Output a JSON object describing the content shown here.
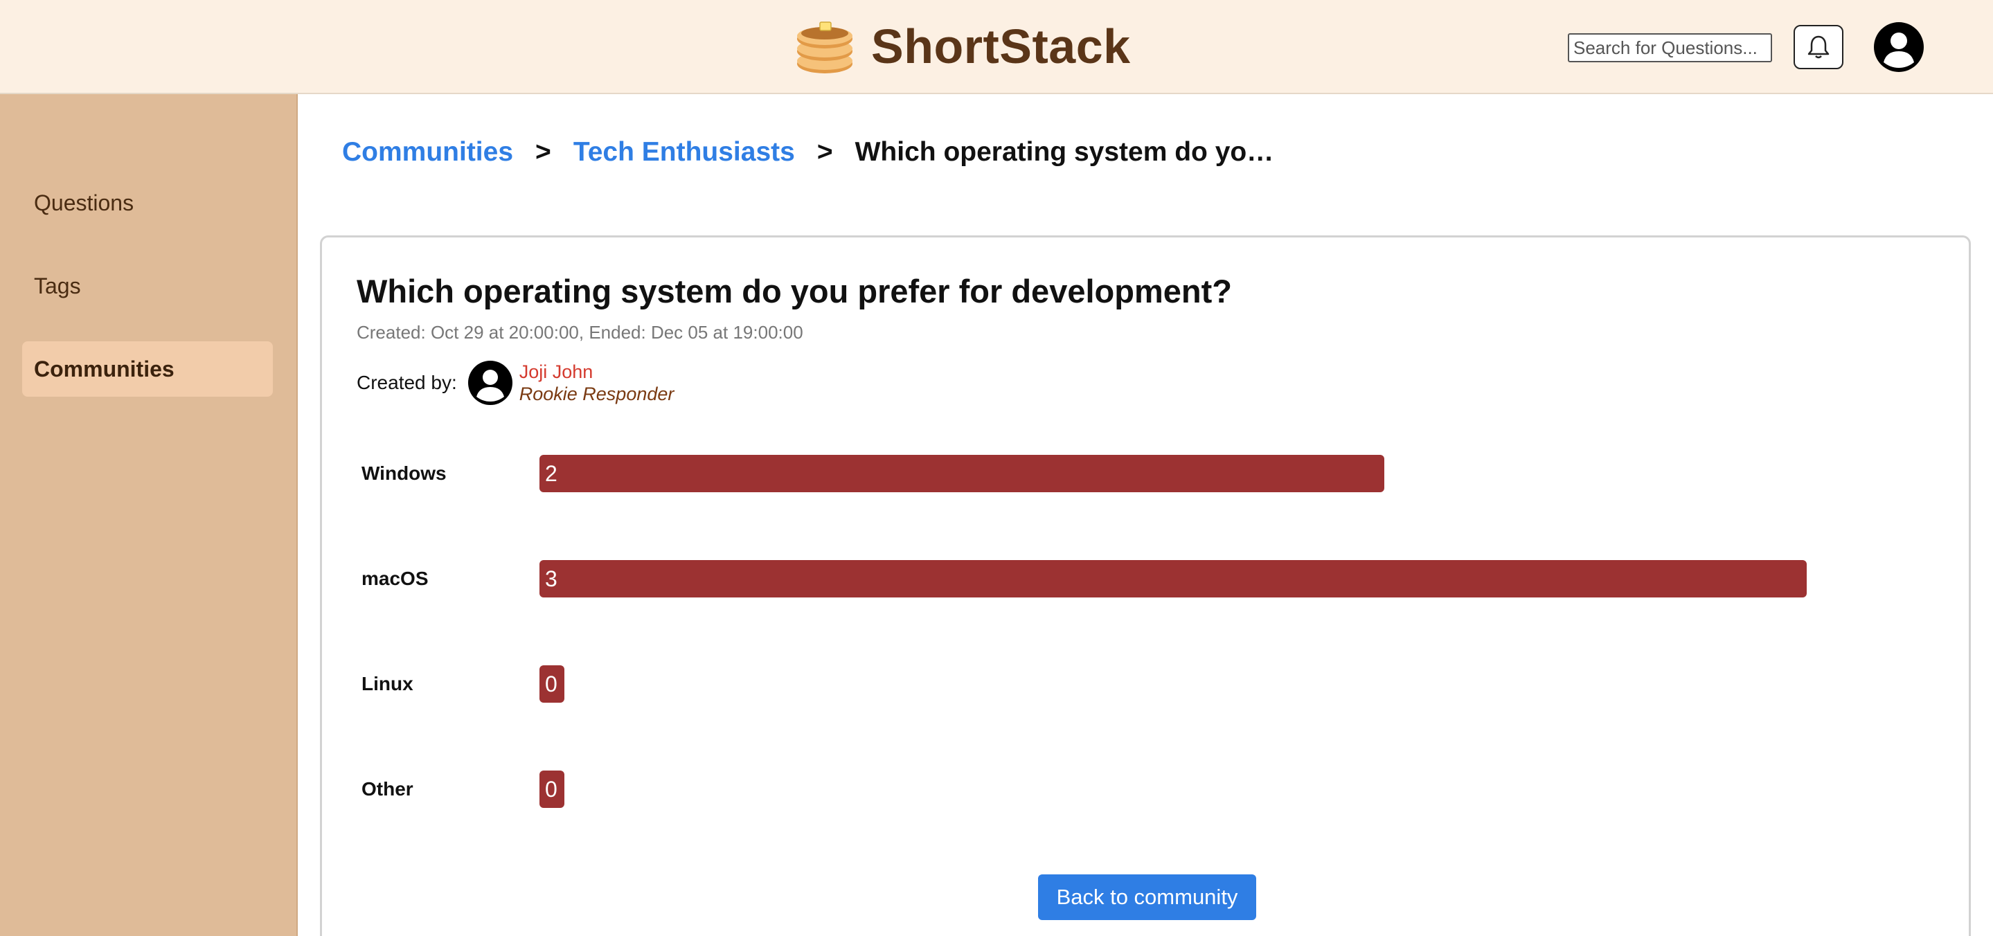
{
  "header": {
    "app_name": "ShortStack",
    "search_placeholder": "Search for Questions...",
    "logo_icon": "pancake-stack-icon",
    "notification_icon": "bell-icon",
    "profile_icon": "user-avatar-icon"
  },
  "sidebar": {
    "items": [
      {
        "label": "Questions",
        "active": false
      },
      {
        "label": "Tags",
        "active": false
      },
      {
        "label": "Communities",
        "active": true
      }
    ]
  },
  "breadcrumb": {
    "items": [
      "Communities",
      "Tech Enthusiasts",
      "Which operating system do yo…"
    ],
    "separator": ">"
  },
  "poll": {
    "title": "Which operating system do you prefer for development?",
    "dates": "Created: Oct 29 at 20:00:00, Ended: Dec 05 at 19:00:00",
    "created_by_label": "Created by:",
    "creator_name": "Joji John",
    "creator_rank": "Rookie Responder",
    "options": [
      {
        "label": "Windows",
        "votes": "2"
      },
      {
        "label": "macOS",
        "votes": "3"
      },
      {
        "label": "Linux",
        "votes": "0"
      },
      {
        "label": "Other",
        "votes": "0"
      }
    ],
    "bar_color": "#9c3232",
    "back_label": "Back to community"
  },
  "colors": {
    "header_bg": "#fcf0e3",
    "sidebar_bg": "#dfbb98",
    "link": "#2f7ee4",
    "brand_text": "#5a3518"
  }
}
